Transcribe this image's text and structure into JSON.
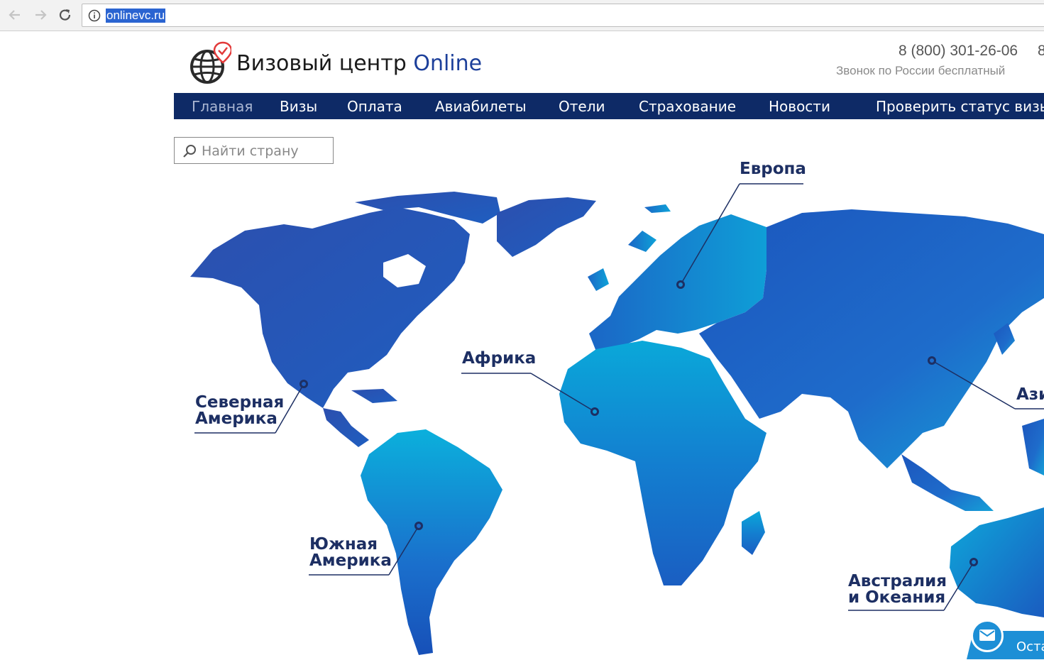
{
  "browser": {
    "url": "onlinevc.ru"
  },
  "header": {
    "title_main": "Визовый центр ",
    "title_accent": "Online",
    "phone": "8 (800) 301-26-06",
    "phone_extra": "8",
    "phone_note": "Звонок по России бесплатный"
  },
  "menu": {
    "items": [
      {
        "label": "Главная"
      },
      {
        "label": "Визы"
      },
      {
        "label": "Оплата"
      },
      {
        "label": "Авиабилеты"
      },
      {
        "label": "Отели"
      },
      {
        "label": "Страхование"
      },
      {
        "label": "Новости"
      },
      {
        "label": "Проверить статус визы"
      }
    ]
  },
  "search": {
    "placeholder": "Найти страну"
  },
  "regions": {
    "north_america": {
      "line1": "Северная",
      "line2": "Америка"
    },
    "south_america": {
      "line1": "Южная",
      "line2": "Америка"
    },
    "africa": {
      "line1": "Африка"
    },
    "europe": {
      "line1": "Европа"
    },
    "asia": {
      "line1": "Ази"
    },
    "australia": {
      "line1": "Австралия",
      "line2": "и Океания"
    }
  },
  "feedback": {
    "label": "Оста"
  },
  "colors": {
    "menu_bg": "#0e2a66",
    "map_blue": "#1e5fbd",
    "map_light": "#0aa7d8",
    "label": "#1d2f63",
    "accent": "#1c3f9a"
  },
  "icons": {
    "back": "arrow-left-icon",
    "forward": "arrow-right-icon",
    "reload": "reload-icon",
    "info": "info-icon",
    "search": "search-icon",
    "logo": "globe-pin-icon",
    "mail": "mail-icon"
  }
}
